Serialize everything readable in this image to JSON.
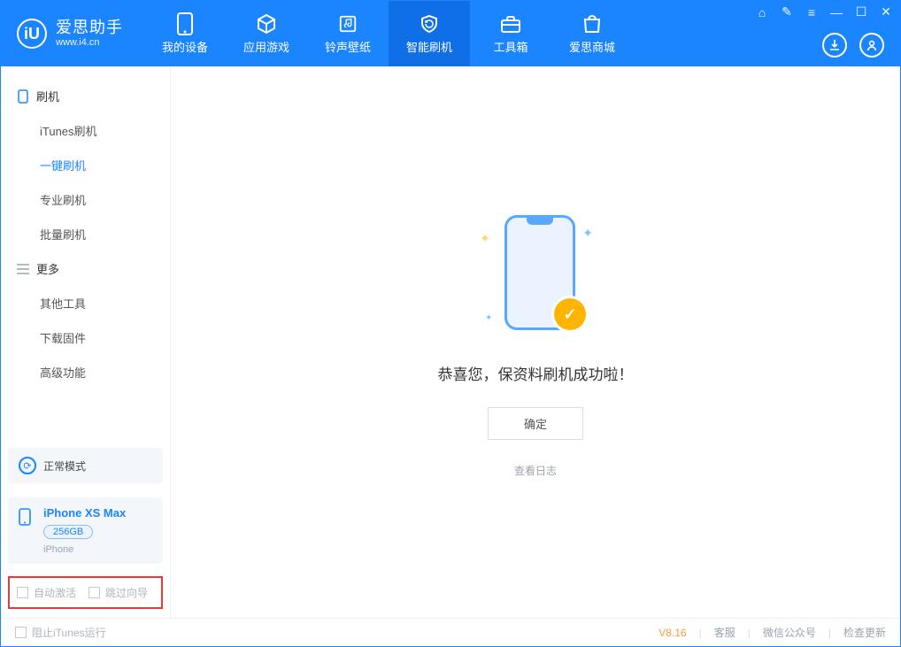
{
  "brand": {
    "title": "爱思助手",
    "subtitle": "www.i4.cn",
    "logo_letter": "iU"
  },
  "tabs": [
    {
      "label": "我的设备",
      "icon": "device-icon"
    },
    {
      "label": "应用游戏",
      "icon": "cube-icon"
    },
    {
      "label": "铃声壁纸",
      "icon": "music-folder-icon"
    },
    {
      "label": "智能刷机",
      "icon": "refresh-shield-icon",
      "active": true
    },
    {
      "label": "工具箱",
      "icon": "toolbox-icon"
    },
    {
      "label": "爱思商城",
      "icon": "bag-icon"
    }
  ],
  "window_controls": {
    "icons": [
      "shirt-icon",
      "feedback-icon",
      "menu-icon",
      "minimize-icon",
      "maximize-icon",
      "close-icon"
    ]
  },
  "header_actions": {
    "download": "download-icon",
    "user": "user-icon"
  },
  "sidebar": {
    "sections": [
      {
        "title": "刷机",
        "icon": "phone-icon",
        "items": [
          {
            "label": "iTunes刷机"
          },
          {
            "label": "一键刷机",
            "active": true
          },
          {
            "label": "专业刷机"
          },
          {
            "label": "批量刷机"
          }
        ]
      },
      {
        "title": "更多",
        "icon": "list-icon",
        "items": [
          {
            "label": "其他工具"
          },
          {
            "label": "下载固件"
          },
          {
            "label": "高级功能"
          }
        ]
      }
    ],
    "mode_card": {
      "label": "正常模式"
    },
    "device_card": {
      "name": "iPhone XS Max",
      "capacity": "256GB",
      "type": "iPhone"
    },
    "options": [
      {
        "label": "自动激活",
        "checked": false
      },
      {
        "label": "跳过向导",
        "checked": false
      }
    ]
  },
  "main": {
    "success_text": "恭喜您，保资料刷机成功啦！",
    "ok_button": "确定",
    "view_log": "查看日志"
  },
  "statusbar": {
    "block_itunes": "阻止iTunes运行",
    "version": "V8.16",
    "links": [
      "客服",
      "微信公众号",
      "检查更新"
    ]
  }
}
